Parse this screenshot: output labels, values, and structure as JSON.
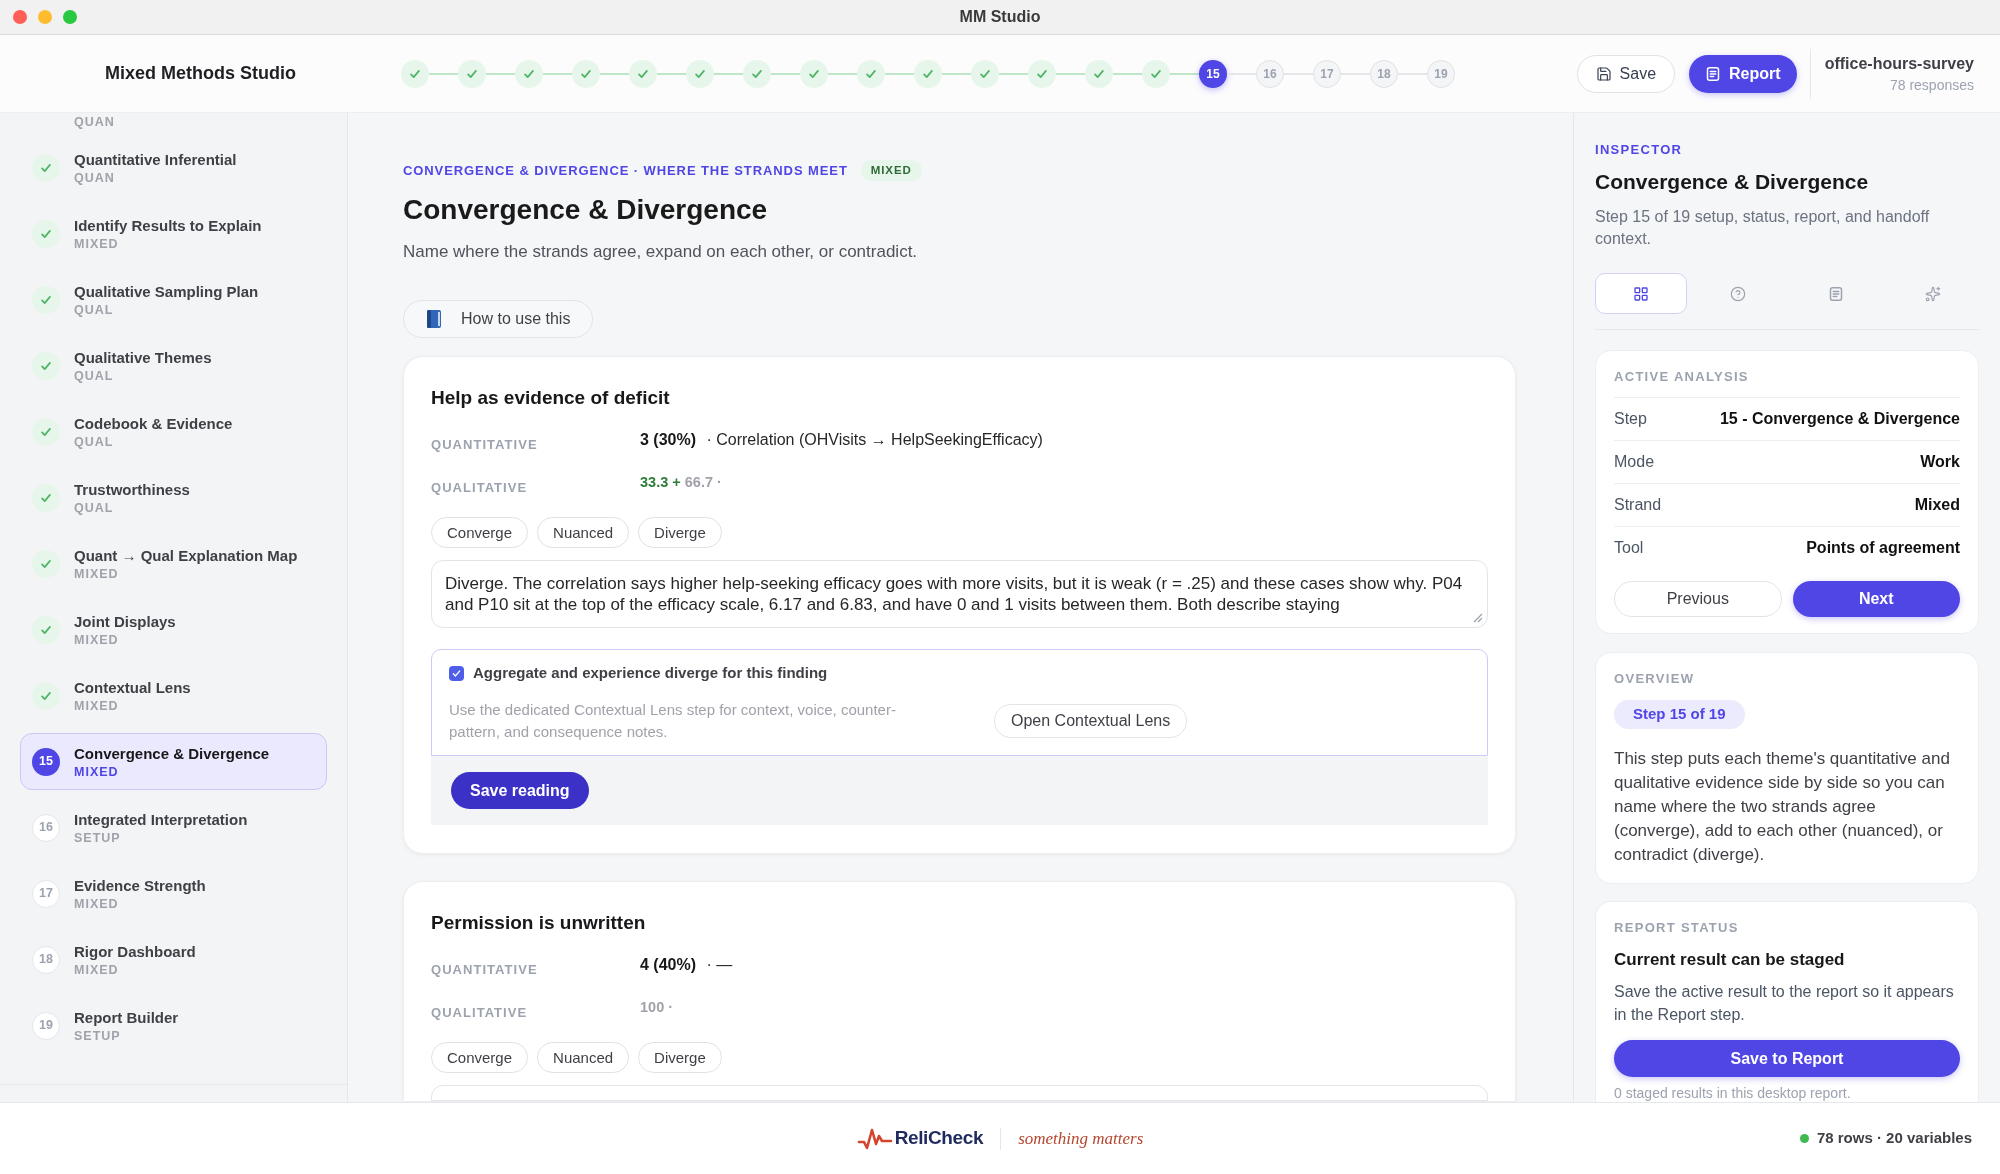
{
  "window": {
    "title": "MM Studio"
  },
  "header": {
    "app_name": "Mixed Methods Studio",
    "steps": [
      {
        "done": true,
        "selected": false
      },
      {
        "done": true,
        "selected": false
      },
      {
        "done": true,
        "selected": false
      },
      {
        "done": true,
        "selected": false
      },
      {
        "done": true,
        "selected": false
      },
      {
        "done": true,
        "selected": false
      },
      {
        "done": true,
        "selected": false
      },
      {
        "done": true,
        "selected": false
      },
      {
        "done": true,
        "selected": false
      },
      {
        "done": true,
        "selected": false
      },
      {
        "done": true,
        "selected": false
      },
      {
        "done": true,
        "selected": false
      },
      {
        "done": true,
        "selected": false
      },
      {
        "done": true,
        "selected": false
      },
      {
        "done": false,
        "selected": true,
        "label": "15"
      },
      {
        "done": false,
        "selected": false,
        "label": "16"
      },
      {
        "done": false,
        "selected": false,
        "label": "17"
      },
      {
        "done": false,
        "selected": false,
        "label": "18"
      },
      {
        "done": false,
        "selected": false,
        "label": "19"
      }
    ],
    "save_button": "Save",
    "report_button": "Report",
    "dataset": {
      "name": "office-hours-survey",
      "responses": "78 responses"
    }
  },
  "sidebar": {
    "clipped_tag": "QUAN",
    "items": [
      {
        "name": "Quantitative Inferential",
        "tag": "QUAN",
        "done": true,
        "selected": false
      },
      {
        "name": "Identify Results to Explain",
        "tag": "MIXED",
        "done": true,
        "selected": false
      },
      {
        "name": "Qualitative Sampling Plan",
        "tag": "QUAL",
        "done": true,
        "selected": false
      },
      {
        "name": "Qualitative Themes",
        "tag": "QUAL",
        "done": true,
        "selected": false
      },
      {
        "name": "Codebook & Evidence",
        "tag": "QUAL",
        "done": true,
        "selected": false
      },
      {
        "name": "Trustworthiness",
        "tag": "QUAL",
        "done": true,
        "selected": false
      },
      {
        "name": "Quant → Qual Explanation Map",
        "tag": "MIXED",
        "done": true,
        "selected": false
      },
      {
        "name": "Joint Displays",
        "tag": "MIXED",
        "done": true,
        "selected": false
      },
      {
        "name": "Contextual Lens",
        "tag": "MIXED",
        "done": true,
        "selected": false
      },
      {
        "name": "Convergence & Divergence",
        "tag": "MIXED",
        "done": false,
        "selected": true,
        "number": "15"
      },
      {
        "name": "Integrated Interpretation",
        "tag": "SETUP",
        "done": false,
        "selected": false,
        "number": "16"
      },
      {
        "name": "Evidence Strength",
        "tag": "MIXED",
        "done": false,
        "selected": false,
        "number": "17"
      },
      {
        "name": "Rigor Dashboard",
        "tag": "MIXED",
        "done": false,
        "selected": false,
        "number": "18"
      },
      {
        "name": "Report Builder",
        "tag": "SETUP",
        "done": false,
        "selected": false,
        "number": "19"
      }
    ]
  },
  "main": {
    "eyebrow": "CONVERGENCE & DIVERGENCE · WHERE THE STRANDS MEET",
    "strand_badge": "MIXED",
    "title": "Convergence & Divergence",
    "subtitle": "Name where the strands agree, expand on each other, or contradict.",
    "help_button": "How to use this",
    "findings": [
      {
        "title": "Help as evidence of deficit",
        "quantitative": {
          "label": "QUANTITATIVE",
          "count": "3 (30%)",
          "detail": "· Correlation (OHVisits → HelpSeekingEfficacy)"
        },
        "qualitative": {
          "label": "QUALITATIVE",
          "parts": [
            {
              "text": "33.3 +",
              "kind": "positive"
            },
            {
              "text": "66.7 ·",
              "kind": "muted"
            }
          ]
        },
        "choices": [
          {
            "label": "Converge",
            "selected": false
          },
          {
            "label": "Nuanced",
            "selected": false
          },
          {
            "label": "Diverge",
            "selected": false
          }
        ],
        "reading": "Diverge. The correlation says higher help-seeking efficacy goes with more visits, but it is weak (r = .25) and these cases show why. P04 and P10 sit at the top of the efficacy scale, 6.17 and 6.83, and have 0 and 1 visits between them. Both describe staying",
        "divergence_note": {
          "checked": true,
          "label": "Aggregate and experience diverge for this finding",
          "hint": "Use the dedicated Contextual Lens step for context, voice, counter-pattern, and consequence notes.",
          "button": "Open Contextual Lens"
        },
        "save_button": "Save reading"
      },
      {
        "title": "Permission is unwritten",
        "quantitative": {
          "label": "QUANTITATIVE",
          "count": "4 (40%)",
          "detail": "· —"
        },
        "qualitative": {
          "label": "QUALITATIVE",
          "parts": [
            {
              "text": "100 ·",
              "kind": "muted"
            }
          ]
        },
        "choices": [
          {
            "label": "Converge",
            "selected": false
          },
          {
            "label": "Nuanced",
            "selected": false
          },
          {
            "label": "Diverge",
            "selected": false
          }
        ]
      }
    ]
  },
  "inspector": {
    "eyebrow": "INSPECTOR",
    "title": "Convergence & Divergence",
    "description": "Step 15 of 19 setup, status, report, and handoff context.",
    "tabs": [
      {
        "kind": "grid",
        "selected": true
      },
      {
        "kind": "help",
        "selected": false
      },
      {
        "kind": "document",
        "selected": false
      },
      {
        "kind": "sparkles",
        "selected": false
      }
    ],
    "active_analysis": {
      "heading": "ACTIVE ANALYSIS",
      "rows": [
        {
          "label": "Step",
          "value": "15 - Convergence & Divergence"
        },
        {
          "label": "Mode",
          "value": "Work"
        },
        {
          "label": "Strand",
          "value": "Mixed"
        },
        {
          "label": "Tool",
          "value": "Points of agreement"
        }
      ],
      "previous_button": "Previous",
      "next_button": "Next"
    },
    "overview": {
      "heading": "OVERVIEW",
      "chip": "Step 15 of 19",
      "text": "This step puts each theme's quantitative and qualitative evidence side by side so you can name where the two strands agree (converge), add to each other (nuanced), or contradict (diverge)."
    },
    "report_status": {
      "heading": "REPORT STATUS",
      "title": "Current result can be staged",
      "text": "Save the active result to the report so it appears in the Report step.",
      "button": "Save to Report",
      "note": "0 staged results in this desktop report."
    }
  },
  "footer": {
    "brand": "ReliCheck",
    "tagline": "something matters",
    "status": "78 rows · 20 variables"
  }
}
